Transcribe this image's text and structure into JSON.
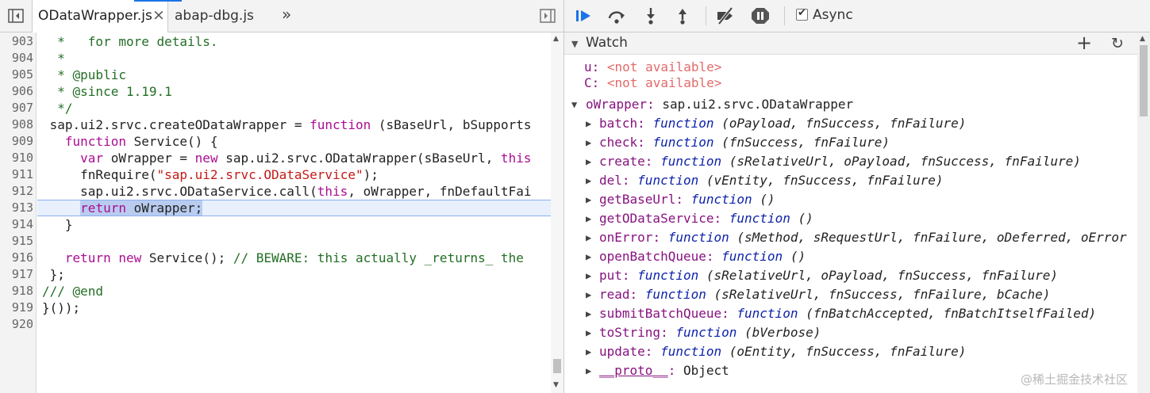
{
  "editor": {
    "tabs": [
      {
        "label": "ODataWrapper.js",
        "close": "×",
        "active": true
      },
      {
        "label": "abap-dbg.js",
        "active": false
      }
    ],
    "more_tabs": "»",
    "lines": [
      {
        "num": "903",
        "html": "<span class=\"cm\">  *   for more details.</span>"
      },
      {
        "num": "904",
        "html": "<span class=\"cm\">  *</span>"
      },
      {
        "num": "905",
        "html": "<span class=\"cm\">  * @public</span>"
      },
      {
        "num": "906",
        "html": "<span class=\"cm\">  * @since 1.19.1</span>"
      },
      {
        "num": "907",
        "html": "<span class=\"cm\">  */</span>"
      },
      {
        "num": "908",
        "html": " sap.ui2.srvc.createODataWrapper = <span class=\"kw\">function</span> (sBaseUrl, bSupports"
      },
      {
        "num": "909",
        "html": "   <span class=\"kw\">function</span> Service() {"
      },
      {
        "num": "910",
        "html": "     <span class=\"kw\">var</span> oWrapper = <span class=\"kw\">new</span> sap.ui2.srvc.ODataWrapper(sBaseUrl, <span class=\"kw\">this</span>"
      },
      {
        "num": "911",
        "html": "     fnRequire(<span class=\"str\">\"sap.ui2.srvc.ODataService\"</span>);"
      },
      {
        "num": "912",
        "html": "     sap.ui2.srvc.ODataService.call(<span class=\"kw\">this</span>, oWrapper, fnDefaultFai"
      },
      {
        "num": "913",
        "html": "     <span id=\"selrun\"><span class=\"kw\">return</span> oWrapper;</span>"
      },
      {
        "num": "914",
        "html": "   }"
      },
      {
        "num": "915",
        "html": ""
      },
      {
        "num": "916",
        "html": "   <span class=\"kw\">return</span> <span class=\"kw\">new</span> Service(); <span class=\"cm\">// BEWARE: this actually _returns_ the</span>"
      },
      {
        "num": "917",
        "html": " };"
      },
      {
        "num": "918",
        "html": "<span class=\"cm\">/// @end</span>"
      },
      {
        "num": "919",
        "html": "}());"
      },
      {
        "num": "920",
        "html": ""
      }
    ]
  },
  "debugger": {
    "toolbar": {
      "resume": "resume-icon",
      "step_over": "step-over-icon",
      "step_into": "step-into-icon",
      "step_out": "step-out-icon",
      "deactivate": "deactivate-breakpoints-icon",
      "pause_exceptions": "pause-on-exceptions-icon",
      "async_label": "Async",
      "async_checked": true
    },
    "watch": {
      "title": "Watch",
      "add": "+",
      "refresh": "↻",
      "expressions": [
        {
          "key": "u",
          "value": "<not available>"
        },
        {
          "key": "C",
          "value": "<not available>"
        }
      ],
      "object": {
        "key": "oWrapper",
        "value": "sap.ui2.srvc.ODataWrapper"
      },
      "props": [
        {
          "name": "batch",
          "fn": "function",
          "params": "(oPayload, fnSuccess, fnFailure)"
        },
        {
          "name": "check",
          "fn": "function",
          "params": "(fnSuccess, fnFailure)"
        },
        {
          "name": "create",
          "fn": "function",
          "params": "(sRelativeUrl, oPayload, fnSuccess, fnFailure)"
        },
        {
          "name": "del",
          "fn": "function",
          "params": "(vEntity, fnSuccess, fnFailure)"
        },
        {
          "name": "getBaseUrl",
          "fn": "function",
          "params": "()"
        },
        {
          "name": "getODataService",
          "fn": "function",
          "params": "()"
        },
        {
          "name": "onError",
          "fn": "function",
          "params": "(sMethod, sRequestUrl, fnFailure, oDeferred, oError"
        },
        {
          "name": "openBatchQueue",
          "fn": "function",
          "params": "()"
        },
        {
          "name": "put",
          "fn": "function",
          "params": "(sRelativeUrl, oPayload, fnSuccess, fnFailure)"
        },
        {
          "name": "read",
          "fn": "function",
          "params": "(sRelativeUrl, fnSuccess, fnFailure, bCache)"
        },
        {
          "name": "submitBatchQueue",
          "fn": "function",
          "params": "(fnBatchAccepted, fnBatchItselfFailed)"
        },
        {
          "name": "toString",
          "fn": "function",
          "params": "(bVerbose)"
        },
        {
          "name": "update",
          "fn": "function",
          "params": "(oEntity, fnSuccess, fnFailure)"
        }
      ],
      "proto": {
        "name": "__proto__",
        "value": "Object"
      }
    }
  },
  "watermark": "@稀土掘金技术社区",
  "colors": {
    "accent": "#1a73e8",
    "keyword": "#aa0d91",
    "string": "#c41a16",
    "comment": "#236e25"
  }
}
